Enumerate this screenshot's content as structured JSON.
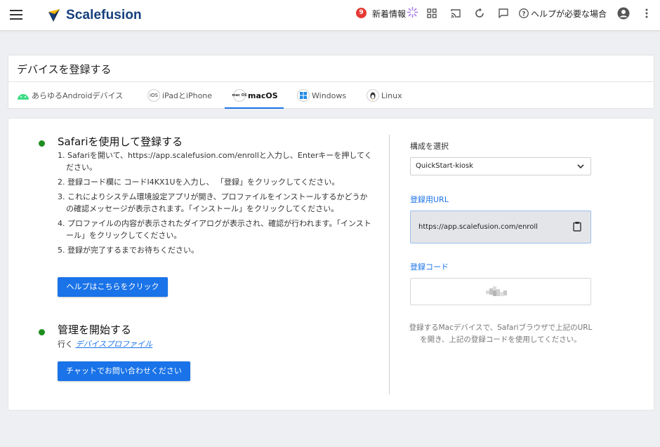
{
  "header": {
    "brand": "Scalefusion",
    "notification_count": "9",
    "whats_new": "新着情報",
    "help": "ヘルプが必要な場合"
  },
  "page": {
    "title": "デバイスを登録する",
    "tabs": [
      {
        "label": "あらゆるAndroidデバイス",
        "icon": "android-icon"
      },
      {
        "label": "iPadとiPhone",
        "icon": "ios-icon",
        "icon_text": "iOS"
      },
      {
        "label": "macOS",
        "icon": "macos-icon",
        "icon_text": "mac OS",
        "active": true
      },
      {
        "label": "Windows",
        "icon": "windows-icon"
      },
      {
        "label": "Linux",
        "icon": "linux-icon"
      }
    ]
  },
  "safari_section": {
    "title": "Safariを使用して登録する",
    "steps": [
      "1. Safariを開いて、https://app.scalefusion.com/enrollと入力し、Enterキーを押してください。",
      "2. 登録コード欄に コードI4KX1Uを入力し、 「登録」をクリックしてください。",
      "3. これによりシステム環境設定アプリが開き、プロファイルをインストールするかどうかの確認メッセージが表示されます。「インストール」をクリックしてください。",
      "4. プロファイルの内容が表示されたダイアログが表示され、確認が行われます。「インストール」をクリックしてください。",
      "5. 登録が完了するまでお待ちください。"
    ],
    "help_button": "ヘルプはこちらをクリック"
  },
  "manage_section": {
    "title": "管理を開始する",
    "go_prefix": "行く",
    "device_profile_link": "デバイスプロファイル",
    "chat_button": "チャットでお問い合わせください"
  },
  "right_panel": {
    "config_label": "構成を選択",
    "config_value": "QuickStart-kiosk",
    "enroll_url_label": "登録用URL",
    "enroll_url": "https://app.scalefusion.com/enroll",
    "enroll_code_label": "登録コード",
    "hint": "登録するMacデバイスで、Safariブラウザで上記のURLを開き、上記の登録コードを使用してください。"
  },
  "colors": {
    "accent": "#1a73e8",
    "brand": "#153f7c",
    "status_green": "#1e8e1e",
    "badge_red": "#e53935"
  }
}
